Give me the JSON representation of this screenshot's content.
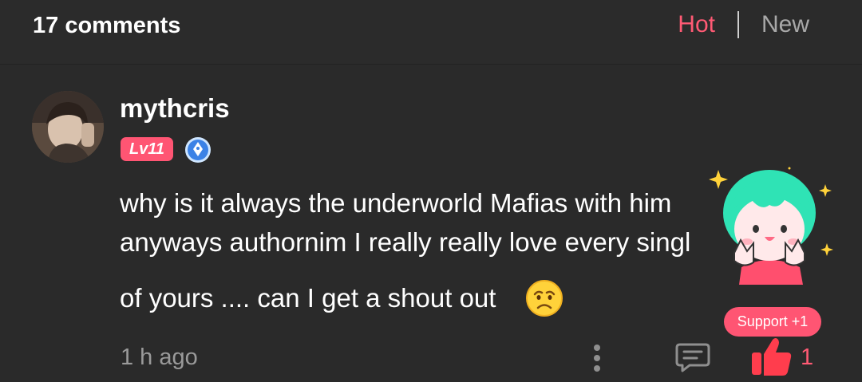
{
  "header": {
    "count_label": "17 comments",
    "sort_hot": "Hot",
    "sort_new": "New"
  },
  "comment": {
    "username": "mythcris",
    "level": "Lv11",
    "lines": [
      "why is it always the underworld Mafias with him",
      "anyways authornim I really really love every singl",
      "of yours .... can I get a shout out"
    ],
    "time": "1 h ago",
    "like_count": "1",
    "support_label": "Support +1"
  },
  "colors": {
    "accent": "#ff5a74",
    "background": "#2a2a2a",
    "muted": "#9a9a9a"
  },
  "icons": {
    "badge": "pen-badge-icon",
    "emoji": "worried-face-emoji-icon",
    "more": "more-vertical-icon",
    "reply": "comment-bubble-icon",
    "like": "thumbs-up-icon"
  }
}
